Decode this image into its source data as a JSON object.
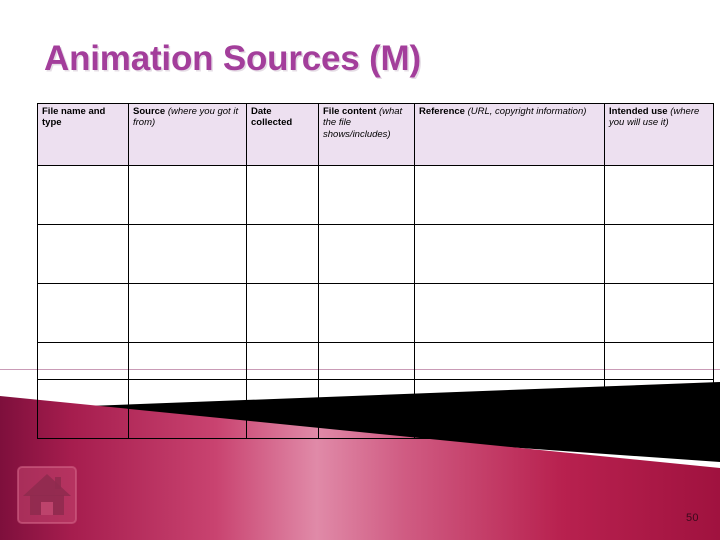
{
  "slide": {
    "title": "Animation Sources (M)",
    "title_color": "#A33E9B",
    "page_number": "50",
    "background_color": "#FFFFFF"
  },
  "table": {
    "header_background": "#EDE0F0",
    "border_color": "#000000",
    "columns": [
      {
        "strong": "File name and type",
        "italic": ""
      },
      {
        "strong": "Source ",
        "italic": "(where you got it from)"
      },
      {
        "strong": "Date collected",
        "italic": ""
      },
      {
        "strong": "File content ",
        "italic": "(what the file shows/includes)"
      },
      {
        "strong": "Reference ",
        "italic": "(URL, copyright information)"
      },
      {
        "strong": "Intended use ",
        "italic": "(where you will use it)"
      }
    ],
    "rows": [
      {
        "cells": [
          "",
          "",
          "",
          "",
          "",
          ""
        ]
      },
      {
        "cells": [
          "",
          "",
          "",
          "",
          "",
          ""
        ]
      },
      {
        "cells": [
          "",
          "",
          "",
          "",
          "",
          ""
        ]
      },
      {
        "cells": [
          "",
          "",
          "",
          "",
          "",
          ""
        ]
      },
      {
        "cells": [
          "",
          "",
          "",
          "",
          "",
          ""
        ]
      }
    ]
  },
  "decoration": {
    "rule_color": "#C99BB6",
    "pale_band_color": "#EFDCE2",
    "wedge_color": "#000000",
    "gradient_dark": "#8E1242",
    "gradient_light": "#E07A9E",
    "gradient_mid": "#BE2558"
  },
  "home_button": {
    "icon": "home-icon",
    "plate_color": "#C2466F",
    "house_color": "#8E2A4E"
  }
}
